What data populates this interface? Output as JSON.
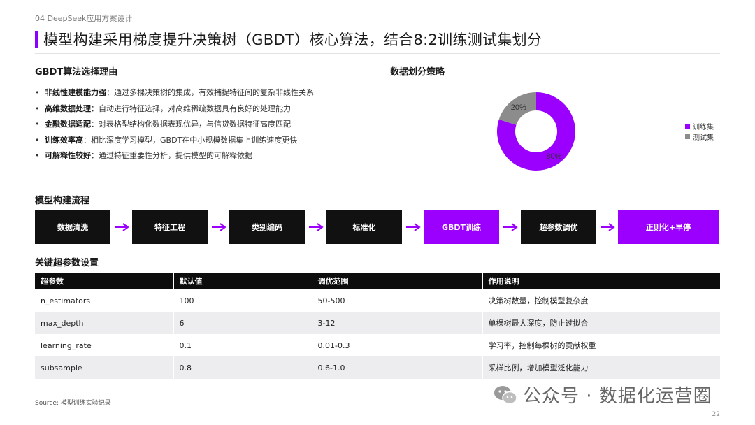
{
  "header": {
    "section_label": "04 DeepSeek应用方案设计",
    "title": "模型构建采用梯度提升决策树（GBDT）核心算法，结合8:2训练测试集划分"
  },
  "reasons": {
    "title": "GBDT算法选择理由",
    "items": [
      {
        "key": "非线性建模能力强",
        "text": "：通过多棵决策树的集成，有效捕捉特征间的复杂非线性关系"
      },
      {
        "key": "高维数据处理",
        "text": "：自动进行特征选择，对高维稀疏数据具有良好的处理能力"
      },
      {
        "key": "金融数据适配",
        "text": "：对表格型结构化数据表现优异，与信贷数据特征高度匹配"
      },
      {
        "key": "训练效率高",
        "text": "：相比深度学习模型，GBDT在中小规模数据集上训练速度更快"
      },
      {
        "key": "可解释性较好",
        "text": "：通过特征重要性分析，提供模型的可解释依据"
      }
    ]
  },
  "split": {
    "title": "数据划分策略"
  },
  "chart_data": {
    "type": "pie",
    "donut": true,
    "categories": [
      "训练集",
      "测试集"
    ],
    "values": [
      80,
      20
    ],
    "value_labels": [
      "80%",
      "20%"
    ],
    "colors": [
      "#9b00ff",
      "#8c8c8c"
    ],
    "legend": "right"
  },
  "flow": {
    "title": "模型构建流程",
    "steps": [
      {
        "label": "数据清洗",
        "highlight": false
      },
      {
        "label": "特征工程",
        "highlight": false
      },
      {
        "label": "类别编码",
        "highlight": false
      },
      {
        "label": "标准化",
        "highlight": false
      },
      {
        "label": "GBDT训练",
        "highlight": true
      },
      {
        "label": "超参数调优",
        "highlight": false
      },
      {
        "label": "正则化+早停",
        "highlight": true
      }
    ]
  },
  "params": {
    "title": "关键超参数设置",
    "headers": [
      "超参数",
      "默认值",
      "调优范围",
      "作用说明"
    ],
    "rows": [
      [
        "n_estimators",
        "100",
        "50-500",
        "决策树数量，控制模型复杂度"
      ],
      [
        "max_depth",
        "6",
        "3-12",
        "单棵树最大深度，防止过拟合"
      ],
      [
        "learning_rate",
        "0.1",
        "0.01-0.3",
        "学习率，控制每棵树的贡献权重"
      ],
      [
        "subsample",
        "0.8",
        "0.6-1.0",
        "采样比例，增加模型泛化能力"
      ]
    ]
  },
  "footer": {
    "source": "Source: 模型训练实验记录",
    "watermark": "公众号 · 数据化运营圈",
    "page_number": "22"
  },
  "colors": {
    "accent": "#9b00ff",
    "dark": "#111111",
    "gray": "#8c8c8c",
    "row_alt": "#ededf0"
  }
}
